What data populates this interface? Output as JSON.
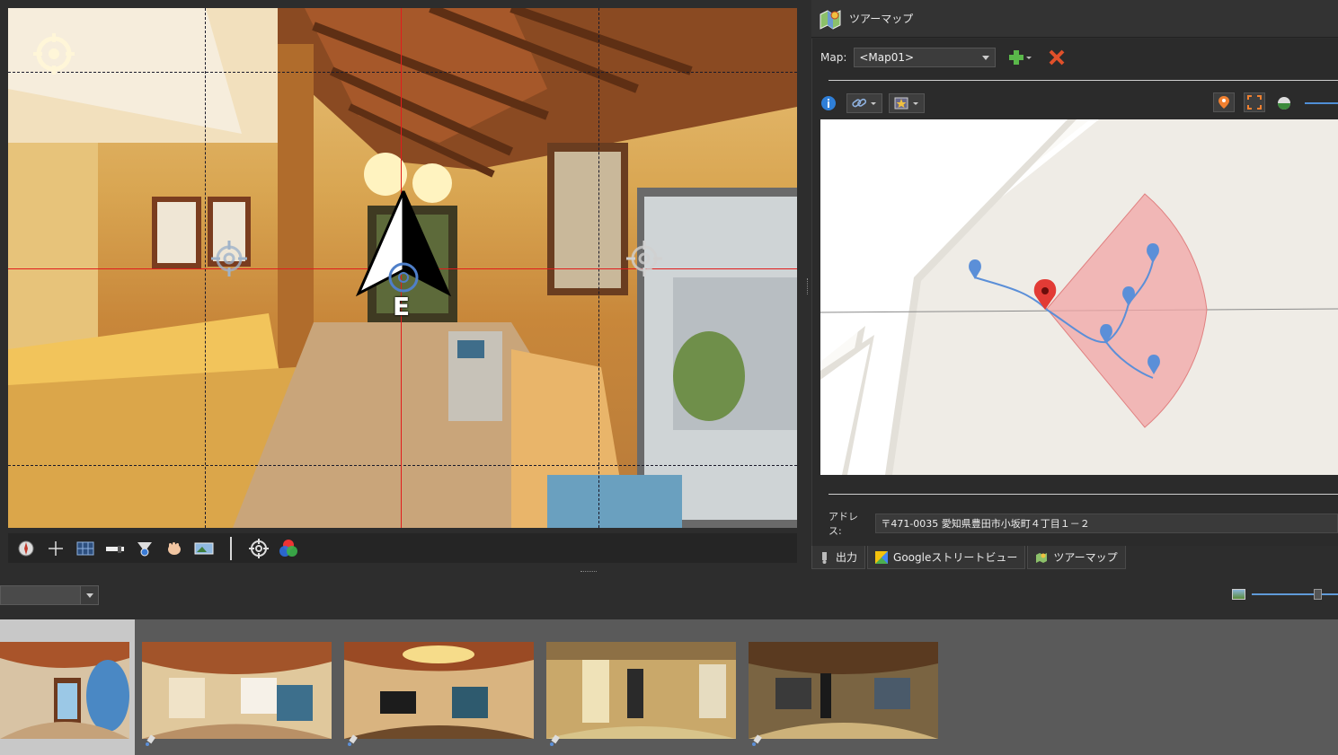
{
  "panel": {
    "title": "ツアーマップ"
  },
  "map_selector": {
    "label": "Map:",
    "value": "<Map01>"
  },
  "address": {
    "label": "アドレス:",
    "value": "〒471-0035 愛知県豊田市小坂町４丁目１－２"
  },
  "tabs": [
    {
      "label": "出力",
      "icon": "output-icon"
    },
    {
      "label": "Googleストリートビュー",
      "icon": "google-maps-icon"
    },
    {
      "label": "ツアーマップ",
      "icon": "tour-map-icon"
    }
  ],
  "viewer": {
    "hotspots": [
      "target-icon",
      "target-icon",
      "target-icon"
    ],
    "compass_label": "E"
  },
  "viewer_toolbar": [
    "compass-icon",
    "crosshair-icon",
    "grid-icon",
    "level-icon",
    "funnel-icon",
    "hand-icon",
    "panorama-icon",
    "target-icon",
    "color-icon"
  ],
  "colors": {
    "accent": "#4f8fd6",
    "delete": "#e0502a",
    "add": "#5ab84a",
    "fov": "#f2a6a6",
    "pin_red": "#e23b35",
    "pin_blue": "#5b8fd8"
  }
}
